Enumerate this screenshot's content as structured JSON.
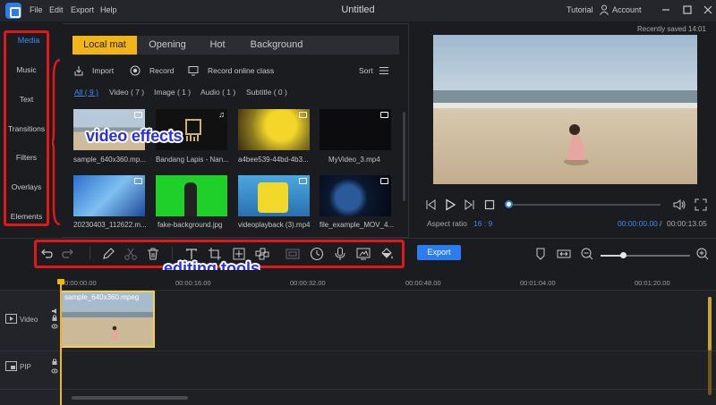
{
  "app": {
    "title": "Untitled",
    "menu": [
      "File",
      "Edit",
      "Export",
      "Help"
    ],
    "tutorial": "Tutorial",
    "account": "Account"
  },
  "sidebar": {
    "media_tab": "Media",
    "items": [
      "Music",
      "Text",
      "Transitions",
      "Filters",
      "Overlays",
      "Elements"
    ]
  },
  "media": {
    "tabs": [
      "Local mat",
      "Opening",
      "Hot",
      "Background"
    ],
    "actions": {
      "import": "Import",
      "record": "Record",
      "record_online": "Record online class",
      "sort": "Sort"
    },
    "filters": [
      "All ( 9 )",
      "Video ( 7 )",
      "Image ( 1 )",
      "Audio ( 1 )",
      "Subtitle ( 0 )"
    ],
    "items": [
      {
        "name": "sample_640x360.mp...",
        "kind": "video"
      },
      {
        "name": "Bandang Lapis - Nan...",
        "kind": "audio"
      },
      {
        "name": "a4bee539-44bd-4b3...",
        "kind": "video"
      },
      {
        "name": "MyVideo_3.mp4",
        "kind": "video"
      },
      {
        "name": "20230403_112622.m...",
        "kind": "video"
      },
      {
        "name": "fake-background.jpg",
        "kind": "image"
      },
      {
        "name": "videoplayback (3).mp4",
        "kind": "video"
      },
      {
        "name": "file_example_MOV_4...",
        "kind": "video"
      }
    ]
  },
  "annotations": {
    "video_effects": "video effects",
    "editing_tools": "editing tools"
  },
  "preview": {
    "saved": "Recently saved 14:01",
    "aspect_label": "Aspect ratio",
    "aspect_value": "16 : 9",
    "time_current": "00:00:00.00",
    "time_sep": "/",
    "time_total": "00:00:13.05"
  },
  "toolbar": {
    "export_label": "Export",
    "icons": [
      "undo-icon",
      "redo-icon",
      "edit-icon",
      "cut-icon",
      "delete-icon",
      "text-icon",
      "crop-icon",
      "fit-icon",
      "mosaic-icon",
      "pip-icon",
      "speed-icon",
      "voiceover-icon",
      "screenshot-icon",
      "color-fill-icon"
    ],
    "zoom_level": 0.26
  },
  "timeline": {
    "ticks": [
      "00:00:00.00",
      "00:00:16.00",
      "00:00:32.00",
      "00:00:48.00",
      "00:01:04.00",
      "00:01:20.00"
    ],
    "tracks": [
      "Video",
      "PIP"
    ],
    "clip_name": "sample_640x360.mpeg"
  },
  "colors": {
    "accent": "#2b7cf0",
    "highlight": "#f2b516",
    "annotation": "#e01818"
  }
}
